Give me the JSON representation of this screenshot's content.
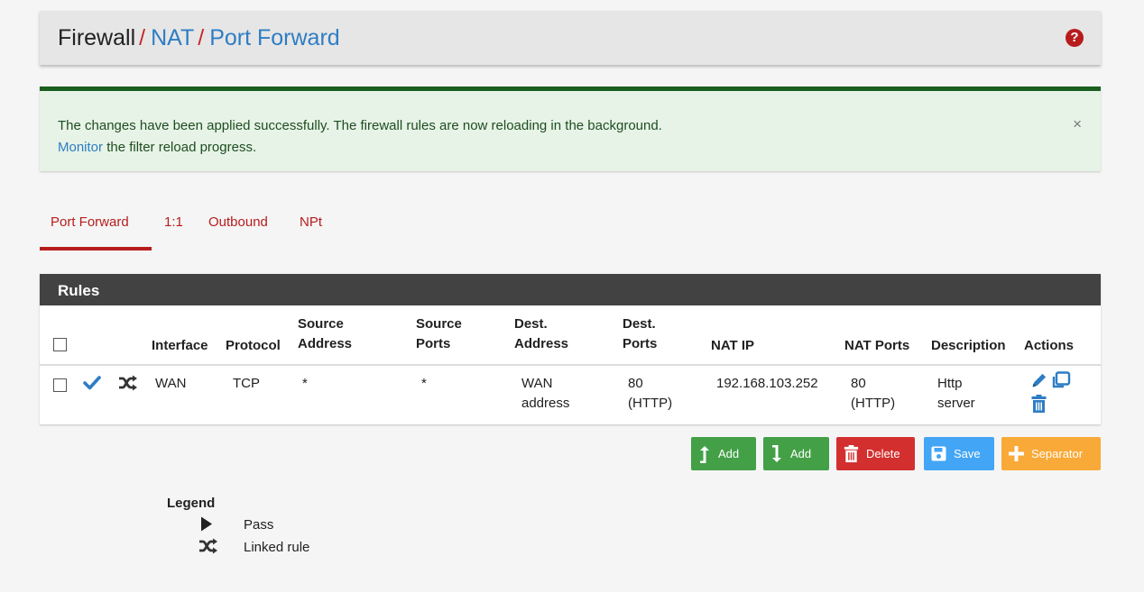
{
  "header": {
    "crumb_firewall": "Firewall",
    "sep": "/",
    "crumb_nat": "NAT",
    "crumb_port_forward": "Port Forward",
    "help_glyph": "?"
  },
  "alert": {
    "line1": "The changes have been applied successfully. The firewall rules are now reloading in the background.",
    "link": "Monitor",
    "line2_rest": " the filter reload progress.",
    "close_glyph": "×"
  },
  "tabs": [
    "Port Forward",
    "1:1",
    "Outbound",
    "NPt"
  ],
  "rules": {
    "title": "Rules",
    "columns": {
      "interface": "Interface",
      "protocol": "Protocol",
      "source_address_1": "Source",
      "source_address_2": "Address",
      "source_ports_1": "Source",
      "source_ports_2": "Ports",
      "dest_address_1": "Dest.",
      "dest_address_2": "Address",
      "dest_ports_1": "Dest.",
      "dest_ports_2": "Ports",
      "nat_ip": "NAT IP",
      "nat_ports": "NAT Ports",
      "description": "Description",
      "actions": "Actions"
    },
    "rows": [
      {
        "status_icon": "checkmark-icon",
        "linked_icon": "shuffle-icon",
        "interface": "WAN",
        "protocol": "TCP",
        "source_address": "*",
        "source_ports": "*",
        "dest_address_1": "WAN",
        "dest_address_2": "address",
        "dest_ports_1": "80",
        "dest_ports_2": "(HTTP)",
        "nat_ip": "192.168.103.252",
        "nat_ports_1": "80",
        "nat_ports_2": "(HTTP)",
        "description_1": "Http",
        "description_2": "server"
      }
    ]
  },
  "buttons": {
    "add_top": "Add",
    "add_bottom": "Add",
    "delete": "Delete",
    "save": "Save",
    "separator": "Separator"
  },
  "legend": {
    "title": "Legend",
    "pass": "Pass",
    "linked_rule": "Linked rule"
  },
  "colors": {
    "accent_red": "#b71c1c",
    "link_blue": "#2e7dc4",
    "success_green": "#1b5e20",
    "panel_dark": "#424242",
    "btn_green": "#43a047",
    "btn_red": "#d32f2f",
    "btn_blue": "#42a5f5",
    "btn_orange": "#f9a937"
  }
}
